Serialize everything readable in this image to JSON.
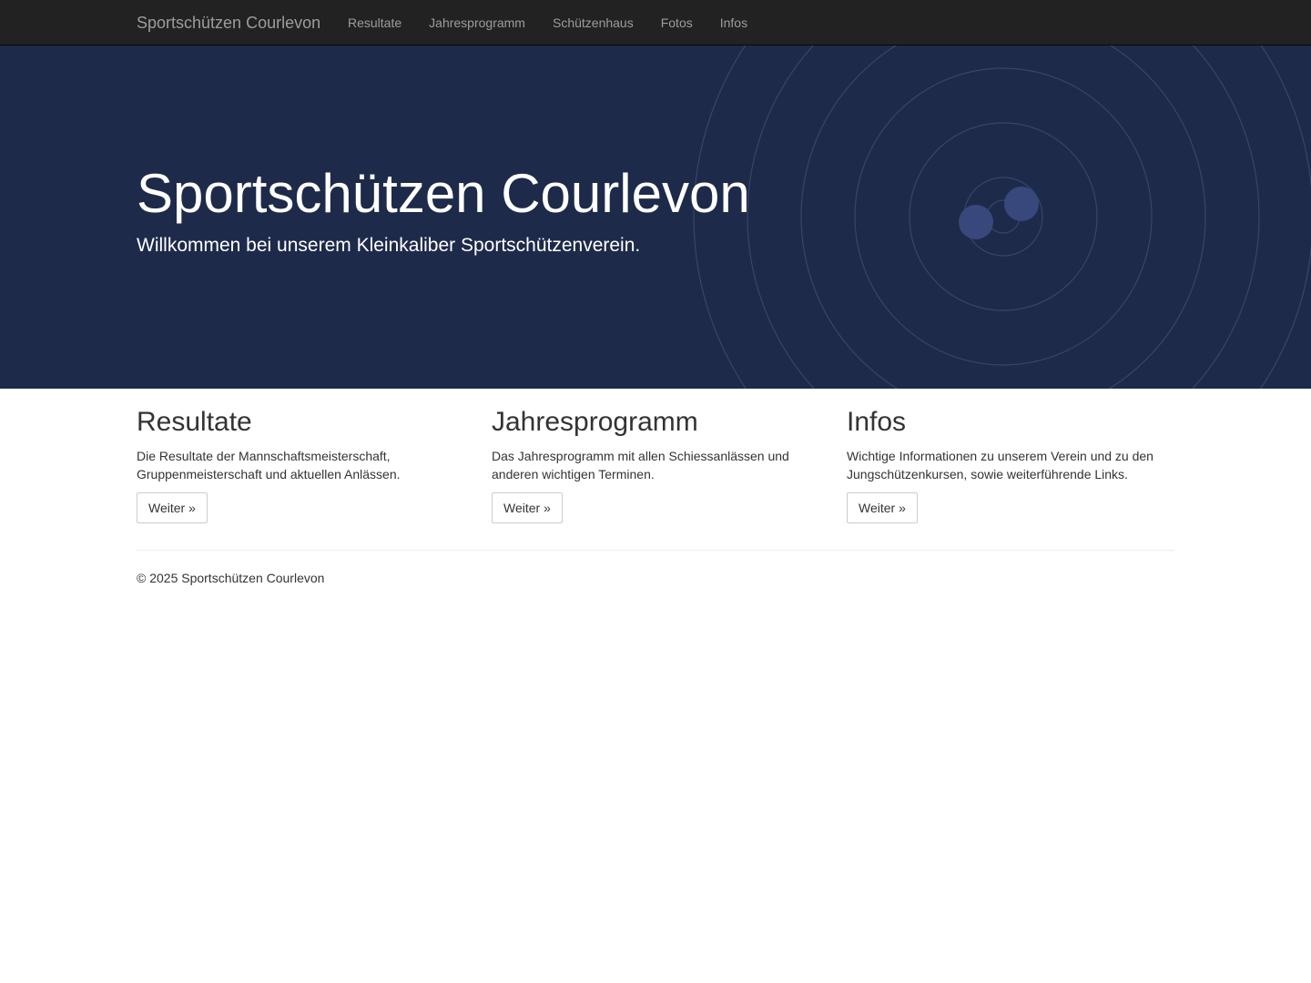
{
  "navbar": {
    "brand": "Sportschützen Courlevon",
    "items": [
      {
        "label": "Resultate"
      },
      {
        "label": "Jahresprogramm"
      },
      {
        "label": "Schützenhaus"
      },
      {
        "label": "Fotos"
      },
      {
        "label": "Infos"
      }
    ]
  },
  "hero": {
    "title": "Sportschützen Courlevon",
    "subtitle": "Willkommen bei unserem Kleinkaliber Sportschützenverein."
  },
  "columns": [
    {
      "title": "Resultate",
      "text": "Die Resultate der Mannschaftsmeisterschaft, Gruppenmeisterschaft und aktuellen Anlässen.",
      "button": "Weiter »"
    },
    {
      "title": "Jahresprogramm",
      "text": "Das Jahresprogramm mit allen Schiessanlässen und anderen wichtigen Terminen.",
      "button": "Weiter »"
    },
    {
      "title": "Infos",
      "text": "Wichtige Informationen zu unserem Verein und zu den Jungschützenkursen, sowie weiterführende Links.",
      "button": "Weiter »"
    }
  ],
  "footer": {
    "copyright": "© 2025 Sportschützen Courlevon"
  },
  "colors": {
    "navbar_bg": "#222222",
    "hero_bg": "#1e2a4a",
    "nav_text": "#9d9d9d"
  }
}
